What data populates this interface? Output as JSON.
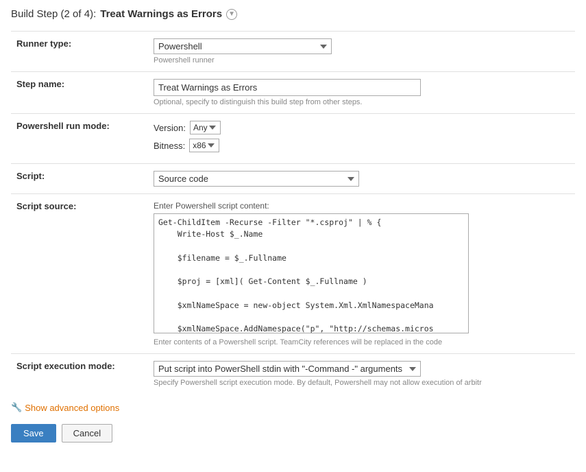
{
  "pageTitle": {
    "prefix": "Build Step (2 of 4): ",
    "stepName": "Treat Warnings as Errors",
    "infoIcon": "▼"
  },
  "form": {
    "runnerType": {
      "label": "Runner type:",
      "value": "Powershell",
      "hint": "Powershell runner",
      "options": [
        "Powershell"
      ]
    },
    "stepName": {
      "label": "Step name:",
      "value": "Treat Warnings as Errors",
      "hint": "Optional, specify to distinguish this build step from other steps."
    },
    "powershellRunMode": {
      "label": "Powershell run mode:",
      "versionLabel": "Version:",
      "versionValue": "Any",
      "versionOptions": [
        "Any"
      ],
      "bitnessLabel": "Bitness:",
      "bitnessValue": "x86",
      "bitnessOptions": [
        "x86"
      ]
    },
    "script": {
      "label": "Script:",
      "value": "Source code",
      "options": [
        "Source code"
      ]
    },
    "scriptSource": {
      "label": "Script source:",
      "enterLabel": "Enter Powershell script content:",
      "content": "Get-ChildItem -Recurse -Filter \"*.csproj\" | % {\n    Write-Host $_.Name\n\n    $filename = $_.Fullname\n\n    $proj = [xml]( Get-Content $_.Fullname )\n\n    $xmlNameSpace = new-object System.Xml.XmlNamespaceMana\n\n    $xmlNameSpace.AddNamespace(\"p\", \"http://schemas.micros",
      "hint": "Enter contents of a Powershell script. TeamCity references will be replaced in the code"
    },
    "scriptExecutionMode": {
      "label": "Script execution mode:",
      "value": "Put script into PowerShell stdin with \"-Command -\" arguments",
      "options": [
        "Put script into PowerShell stdin with \"-Command -\" arguments"
      ],
      "hint": "Specify Powershell script execution mode. By default, Powershell may not allow execution of arbitr"
    }
  },
  "showAdvanced": {
    "label": "Show advanced options"
  },
  "buttons": {
    "save": "Save",
    "cancel": "Cancel"
  }
}
